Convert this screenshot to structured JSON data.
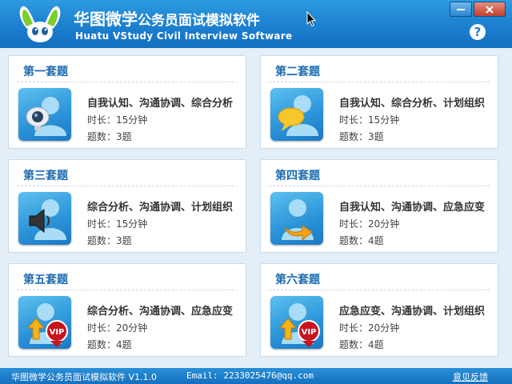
{
  "header": {
    "title_brand": "华图微学",
    "title_product": "公务员面试模拟软件",
    "subtitle": "Huatu VStudy Civil Interview Software",
    "help_label": "?",
    "minimize_label": "—",
    "close_label": "✕"
  },
  "cards": [
    {
      "title": "第一套题",
      "topics": "自我认知、沟通协调、综合分析",
      "duration": "时长：15分钟",
      "count": "题数：3题",
      "icon": "webcam-user-icon"
    },
    {
      "title": "第二套题",
      "topics": "自我认知、综合分析、计划组织",
      "duration": "时长：15分钟",
      "count": "题数：3题",
      "icon": "chat-user-icon"
    },
    {
      "title": "第三套题",
      "topics": "综合分析、沟通协调、计划组织",
      "duration": "时长：15分钟",
      "count": "题数：3题",
      "icon": "speaker-user-icon"
    },
    {
      "title": "第四套题",
      "topics": "自我认知、沟通协调、应急应变",
      "duration": "时长：20分钟",
      "count": "题数：4题",
      "icon": "arrow-user-icon"
    },
    {
      "title": "第五套题",
      "topics": "综合分析、沟通协调、应急应变",
      "duration": "时长：20分钟",
      "count": "题数：4题",
      "icon": "vip-user-icon"
    },
    {
      "title": "第六套题",
      "topics": "应急应变、沟通协调、计划组织",
      "duration": "时长：20分钟",
      "count": "题数：4题",
      "icon": "vip-user-icon"
    }
  ],
  "vip_badge": "VIP",
  "footer": {
    "app_version": "华图微学公务员面试模拟软件 V1.1.0",
    "email": "Email: 2233025476@qq.com",
    "feedback": "意见反馈"
  },
  "colors": {
    "header_blue": "#1c7fcf",
    "title_blue": "#1a69b0",
    "vip_red": "#c8141e"
  }
}
